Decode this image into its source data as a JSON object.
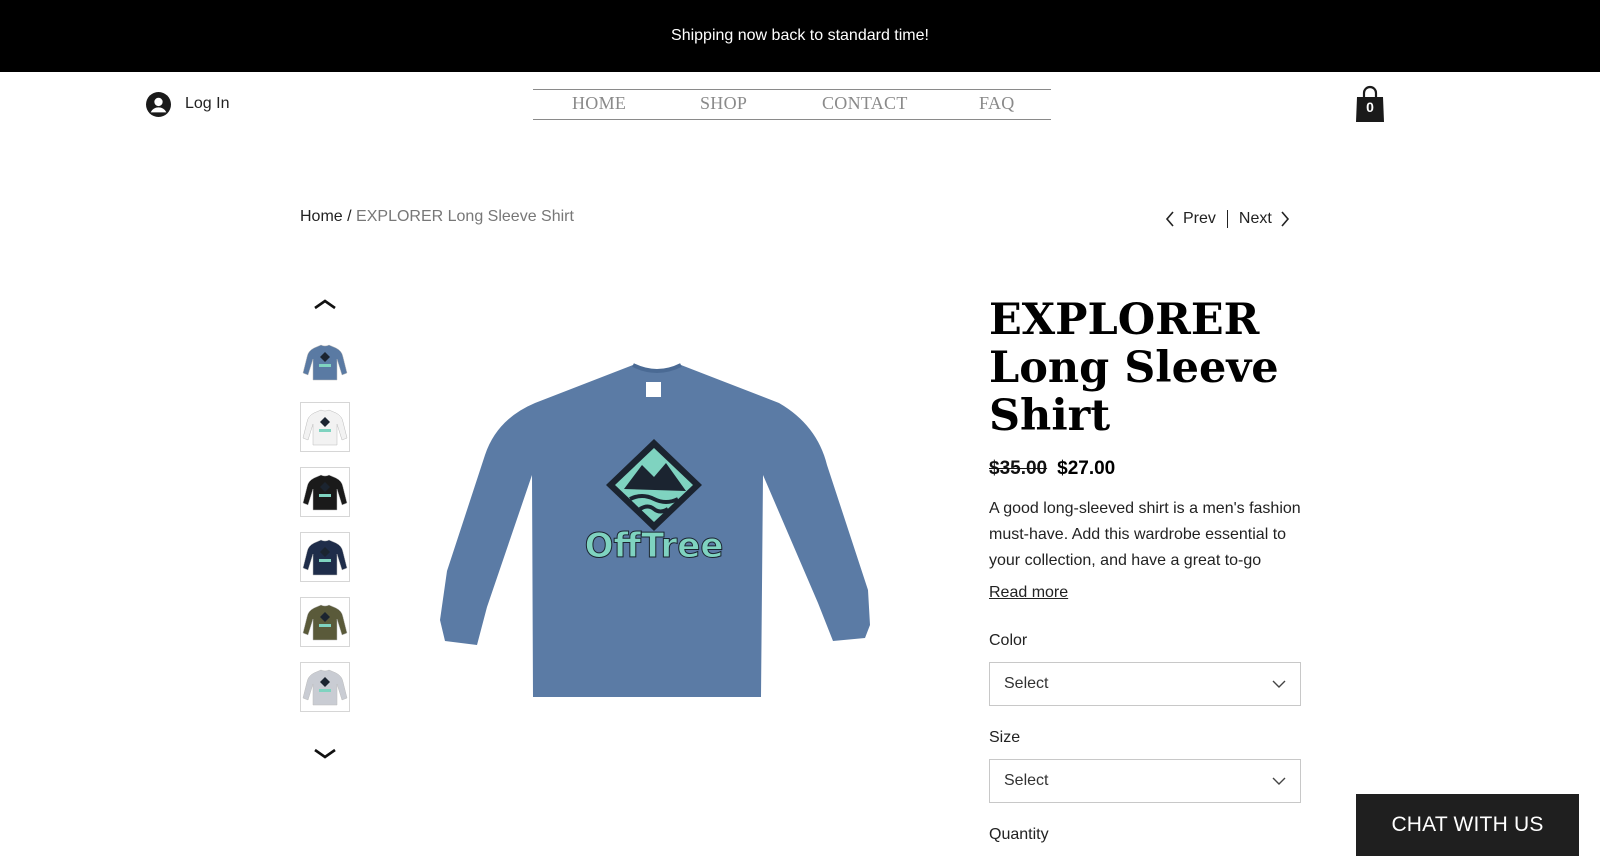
{
  "banner": {
    "text": "Shipping now back to standard time!"
  },
  "header": {
    "login_label": "Log In",
    "nav": [
      "HOME",
      "SHOP",
      "CONTACT",
      "FAQ"
    ],
    "cart_count": "0"
  },
  "breadcrumb": {
    "home": "Home",
    "separator": "/",
    "current": "EXPLORER Long Sleeve Shirt"
  },
  "pager": {
    "prev": "Prev",
    "next": "Next"
  },
  "gallery": {
    "thumbnail_colors": [
      "#5a7aa3",
      "#f2f2f2",
      "#1a1a1a",
      "#1f2d4a",
      "#5a5a3a",
      "#c9ccd3"
    ],
    "logo_text": "OffTree",
    "main_shirt_color": "#5b7ba5",
    "logo_color": "#7fd3c0"
  },
  "product": {
    "title_lines": [
      "EXPLORER",
      "Long Sleeve",
      "Shirt"
    ],
    "price_old": "$35.00",
    "price_new": "$27.00",
    "description": "A good long-sleeved shirt is a men's fashion must-have. Add this wardrobe essential to your collection, and have a great to-go",
    "read_more": "Read more",
    "color_label": "Color",
    "color_value": "Select",
    "size_label": "Size",
    "size_value": "Select",
    "quantity_label": "Quantity"
  },
  "chat": {
    "label": "CHAT WITH US"
  }
}
